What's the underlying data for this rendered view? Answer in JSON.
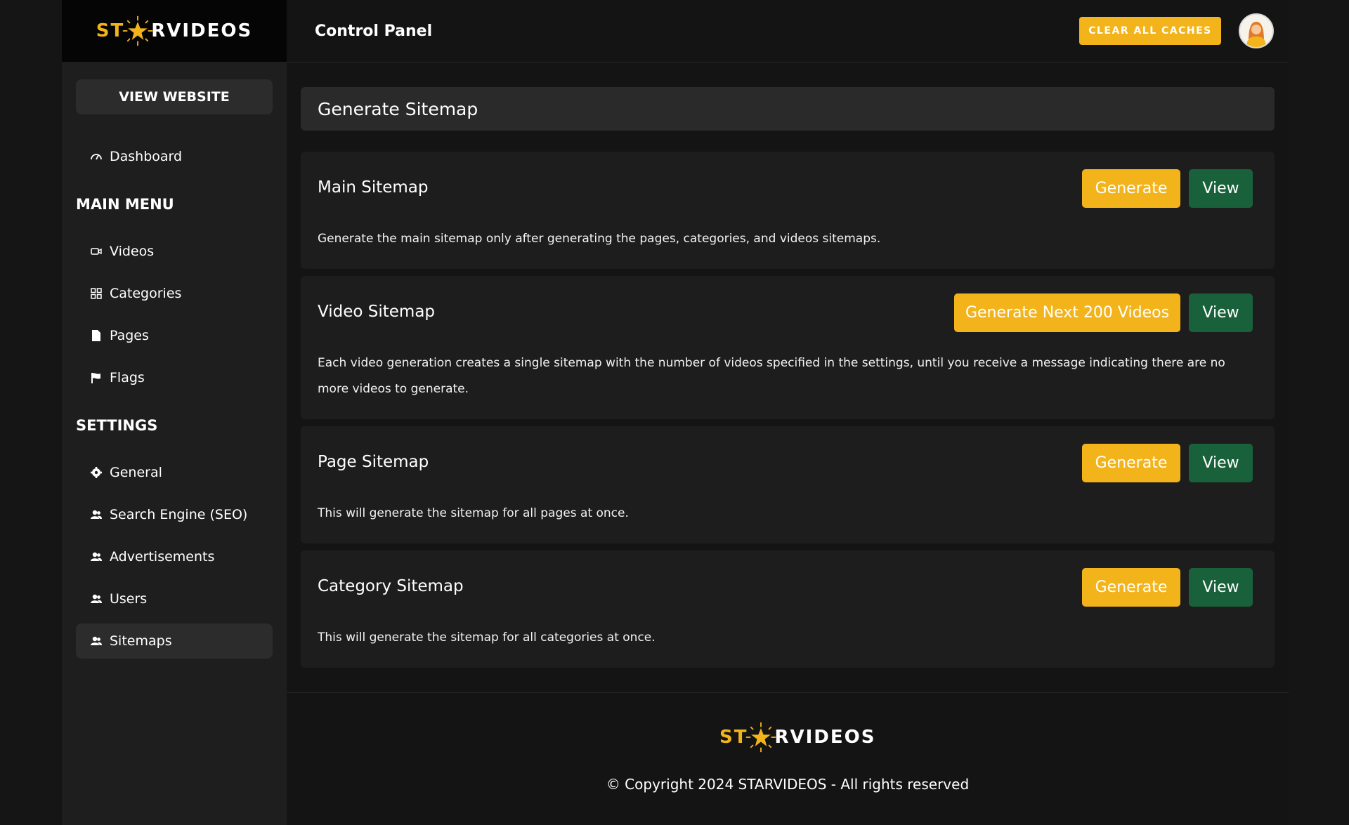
{
  "brand": {
    "logo_left": "ST",
    "logo_right": "RVIDEOS",
    "accent": "#f3b41b"
  },
  "sidebar": {
    "view_website": "VIEW WEBSITE",
    "dashboard": "Dashboard",
    "main_menu_title": "MAIN MENU",
    "main_menu": [
      "Videos",
      "Categories",
      "Pages",
      "Flags"
    ],
    "settings_title": "SETTINGS",
    "settings": [
      "General",
      "Search Engine (SEO)",
      "Advertisements",
      "Users",
      "Sitemaps"
    ],
    "active": "Sitemaps"
  },
  "topbar": {
    "title": "Control Panel",
    "clear_caches": "CLEAR ALL CACHES"
  },
  "page": {
    "title": "Generate Sitemap",
    "cards": [
      {
        "title": "Main Sitemap",
        "generate_label": "Generate",
        "view_label": "View",
        "description": "Generate the main sitemap only after generating the pages, categories, and videos sitemaps."
      },
      {
        "title": "Video Sitemap",
        "generate_label": "Generate Next 200 Videos",
        "view_label": "View",
        "description": "Each video generation creates a single sitemap with the number of videos specified in the settings, until you receive a message indicating there are no more videos to generate."
      },
      {
        "title": "Page Sitemap",
        "generate_label": "Generate",
        "view_label": "View",
        "description": "This will generate the sitemap for all pages at once."
      },
      {
        "title": "Category Sitemap",
        "generate_label": "Generate",
        "view_label": "View",
        "description": "This will generate the sitemap for all categories at once."
      }
    ]
  },
  "footer": {
    "copyright": "© Copyright 2024 STARVIDEOS - All rights reserved"
  },
  "colors": {
    "generate": "#f3b41b",
    "view": "#18613a",
    "sidebar_bg": "#1e1e1e",
    "card_bg": "#1d1d1d"
  }
}
